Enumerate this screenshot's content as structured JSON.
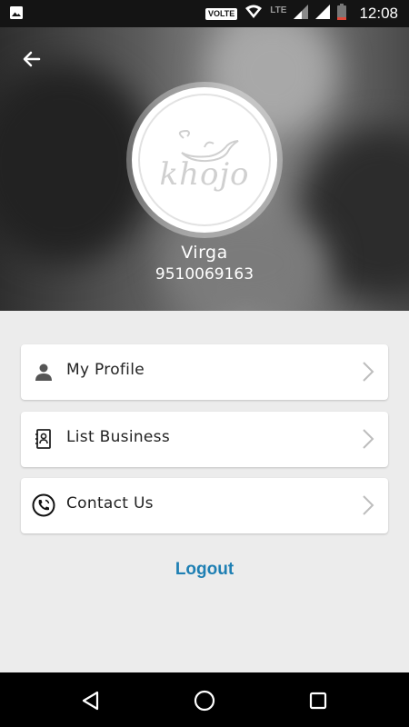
{
  "status_bar": {
    "volte": "VOLTE",
    "network": "LTE",
    "time": "12:08",
    "icons": [
      "image-icon",
      "wifi-icon",
      "signal-icon",
      "signal-icon",
      "battery-icon"
    ]
  },
  "header": {
    "back_icon": "arrow-back-icon",
    "logo_text": "khojo",
    "user_name": "Virga",
    "user_phone": "9510069163"
  },
  "menu": {
    "items": [
      {
        "label": "My Profile",
        "icon": "person-icon"
      },
      {
        "label": "List Business",
        "icon": "contact-book-icon"
      },
      {
        "label": "Contact Us",
        "icon": "phone-call-icon"
      }
    ]
  },
  "logout_label": "Logout",
  "colors": {
    "accent": "#1e7fb3",
    "background": "#ececec",
    "card": "#ffffff"
  },
  "nav_bar": {
    "icons": [
      "back-triangle-icon",
      "home-circle-icon",
      "recents-square-icon"
    ]
  }
}
